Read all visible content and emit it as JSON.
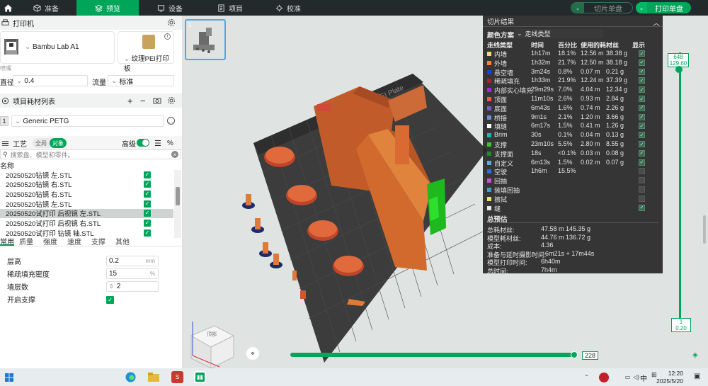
{
  "topbar": {
    "tabs": [
      {
        "label": "准备",
        "icon": "cube-icon"
      },
      {
        "label": "预览",
        "icon": "layers-icon",
        "active": true
      },
      {
        "label": "设备",
        "icon": "device-icon"
      },
      {
        "label": "项目",
        "icon": "document-icon"
      },
      {
        "label": "校准",
        "icon": "calibrate-icon"
      }
    ],
    "slice_button": "切片单盘",
    "print_button": "打印单盘"
  },
  "printer": {
    "header": "打印机",
    "name": "Bambu Lab A1",
    "plate": "纹理PEI打印板",
    "nozzle_header": "喷嘴",
    "nozzle_label": "直径",
    "nozzle_value": "0.4",
    "flow_label": "流量",
    "flow_value": "标准"
  },
  "filaments": {
    "header": "项目耗材列表",
    "index": "1",
    "name": "Generic PETG"
  },
  "process": {
    "header": "工艺",
    "toggle_global": "全局",
    "toggle_object": "对象",
    "advanced": "高级",
    "search_placeholder": "搜索盘、模型和零件。",
    "name_col": "名称",
    "objects": [
      "20250520钻镜 左.STL",
      "20250520钻镜 右.STL",
      "20250520钻镜 右.STL",
      "20250520钻镜 左.STL",
      "20250520试打印 后视镜 左.STL",
      "20250520试打印 后视镜 右.STL",
      "20250520试打印 钻镜 轴.STL"
    ],
    "tabs": [
      "常用",
      "质量",
      "强度",
      "速度",
      "支撑",
      "其他"
    ],
    "params": [
      {
        "label": "层高",
        "value": "0.2",
        "unit": "mm"
      },
      {
        "label": "稀疏填充密度",
        "value": "15",
        "unit": "%"
      },
      {
        "label": "墙层数",
        "value": "2",
        "unit": ""
      },
      {
        "label": "开启支撑",
        "value": "",
        "unit": ""
      }
    ]
  },
  "result": {
    "title": "切片结果",
    "scheme_label": "颜色方案",
    "scheme_value": "走线类型",
    "cols": [
      "走线类型",
      "时间",
      "百分比",
      "使用的耗材丝",
      "",
      "显示"
    ],
    "rows": [
      {
        "name": "内墙",
        "time": "1h17m",
        "pct": "18.1%",
        "len": "12.56 m",
        "wt": "38.38 g",
        "color": "#f2dc6b",
        "show": true
      },
      {
        "name": "外墙",
        "time": "1h32m",
        "pct": "21.7%",
        "len": "12.50 m",
        "wt": "38.18 g",
        "color": "#ff7d38",
        "show": true
      },
      {
        "name": "悬空墙",
        "time": "3m24s",
        "pct": "0.8%",
        "len": "0.07 m",
        "wt": "0.21 g",
        "color": "#1f3fd1",
        "show": true
      },
      {
        "name": "稀疏填充",
        "time": "1h33m",
        "pct": "21.9%",
        "len": "12.24 m",
        "wt": "37.39 g",
        "color": "#b01e2a",
        "show": true
      },
      {
        "name": "内部实心填充",
        "time": "29m29s",
        "pct": "7.0%",
        "len": "4.04 m",
        "wt": "12.34 g",
        "color": "#9b2ed0",
        "show": true
      },
      {
        "name": "顶面",
        "time": "11m10s",
        "pct": "2.6%",
        "len": "0.93 m",
        "wt": "2.84 g",
        "color": "#ff5050",
        "show": true
      },
      {
        "name": "底面",
        "time": "6m43s",
        "pct": "1.6%",
        "len": "0.74 m",
        "wt": "2.26 g",
        "color": "#7b56c7",
        "show": true
      },
      {
        "name": "桥接",
        "time": "9m1s",
        "pct": "2.1%",
        "len": "1.20 m",
        "wt": "3.66 g",
        "color": "#6e8dd8",
        "show": true
      },
      {
        "name": "填缝",
        "time": "6m17s",
        "pct": "1.5%",
        "len": "0.41 m",
        "wt": "1.26 g",
        "color": "#ffffff",
        "show": true
      },
      {
        "name": "Brim",
        "time": "30s",
        "pct": "0.1%",
        "len": "0.04 m",
        "wt": "0.13 g",
        "color": "#00c0b0",
        "show": true
      },
      {
        "name": "支撑",
        "time": "23m10s",
        "pct": "5.5%",
        "len": "2.80 m",
        "wt": "8.55 g",
        "color": "#2fcc2f",
        "show": true
      },
      {
        "name": "支撑面",
        "time": "18s",
        "pct": "<0.1%",
        "len": "0.03 m",
        "wt": "0.08 g",
        "color": "#1d8c2c",
        "show": true
      },
      {
        "name": "自定义",
        "time": "6m13s",
        "pct": "1.5%",
        "len": "0.02 m",
        "wt": "0.07 g",
        "color": "#5fa8d8",
        "show": true
      },
      {
        "name": "空驶",
        "time": "1h6m",
        "pct": "15.5%",
        "len": "",
        "wt": "",
        "color": "#2a6de0",
        "show": false
      },
      {
        "name": "回抽",
        "time": "",
        "pct": "",
        "len": "",
        "wt": "",
        "color": "#d04cd0",
        "show": false
      },
      {
        "name": "装填回抽",
        "time": "",
        "pct": "",
        "len": "",
        "wt": "",
        "color": "#3aa0c8",
        "show": false
      },
      {
        "name": "擦拭",
        "time": "",
        "pct": "",
        "len": "",
        "wt": "",
        "color": "#f0e070",
        "show": false
      },
      {
        "name": "缝",
        "time": "",
        "pct": "",
        "len": "",
        "wt": "",
        "color": "#e8e8e8",
        "show": true
      }
    ],
    "estimate_header": "总预估",
    "estimates": [
      {
        "label": "总耗材丝:",
        "value": "47.58 m   145.35 g"
      },
      {
        "label": "模型耗材丝:",
        "value": "44.76 m   136.72 g"
      },
      {
        "label": "成本:",
        "value": "4.36"
      },
      {
        "label": "准备与延时摄影时间:",
        "value": "6m21s + 17m44s"
      },
      {
        "label": "模型打印时间:",
        "value": "6h40m"
      },
      {
        "label": "总时间:",
        "value": "7h4m"
      }
    ]
  },
  "layer_slider": {
    "top_layer": "648",
    "top_height": "129.60",
    "bottom_layer": "1",
    "bottom_height": "0.20"
  },
  "move_slider": {
    "value": "228"
  },
  "plate": {
    "brand": "Bambu Textured PEI Plate",
    "thumb_index": "1",
    "cube_label": "顶部"
  },
  "taskbar": {
    "time": "12:20",
    "date": "2025/5/20",
    "ime": "中"
  }
}
